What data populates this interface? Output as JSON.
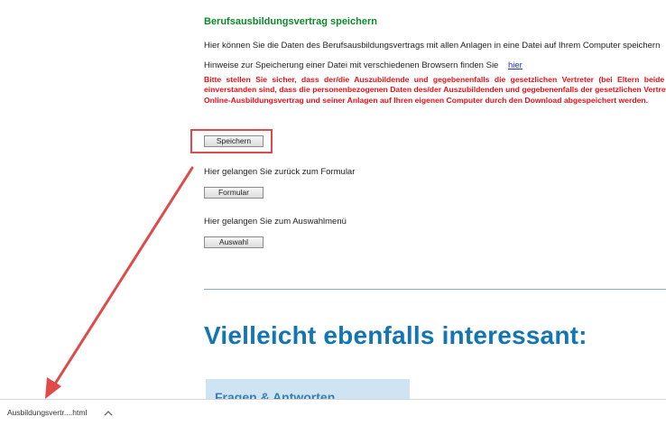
{
  "save_section": {
    "title": "Berufsausbildungsvertrag speichern",
    "intro": "Hier können Sie die Daten des Berufsausbildungsvertrags mit allen Anlagen in eine Datei auf Ihrem Computer speichern",
    "hint_text": "Hinweise zur Speicherung einer Datei mit verschiedenen Browsern finden Sie",
    "hint_link": "hier",
    "warning": "Bitte stellen Sie sicher, dass der/die Auszubildende und gegebenenfalls die gesetzlichen Vertreter (bei Eltern beide Elternteile) einverstanden sind, dass die personenbezogenen Daten des/der Auszubildenden und gegebenenfalls der gesetzlichen Vertreter aus dem Online-Ausbildungsvertrag und seiner Anlagen auf Ihren eigenen Computer durch den Download abgespeichert werden.",
    "save_button": "Speichern"
  },
  "form_section": {
    "text": "Hier gelangen Sie zurück zum Formular",
    "button": "Formular"
  },
  "menu_section": {
    "text": "Hier gelangen Sie zum Auswahlmenü",
    "button": "Auswahl"
  },
  "related": {
    "headline": "Vielleicht ebenfalls interessant:",
    "card_title": "Fragen & Antworten"
  },
  "download_bar": {
    "file_name": "Ausbildungsvertr....html",
    "chevron_icon": "chevron-up-icon"
  },
  "colors": {
    "title_green": "#0a8a2a",
    "warning_red": "#e3121a",
    "link_blue": "#1a33cc",
    "headline_blue": "#1475b3",
    "annotation_red": "#e04a4a",
    "card_bg": "#cfe4f3"
  }
}
